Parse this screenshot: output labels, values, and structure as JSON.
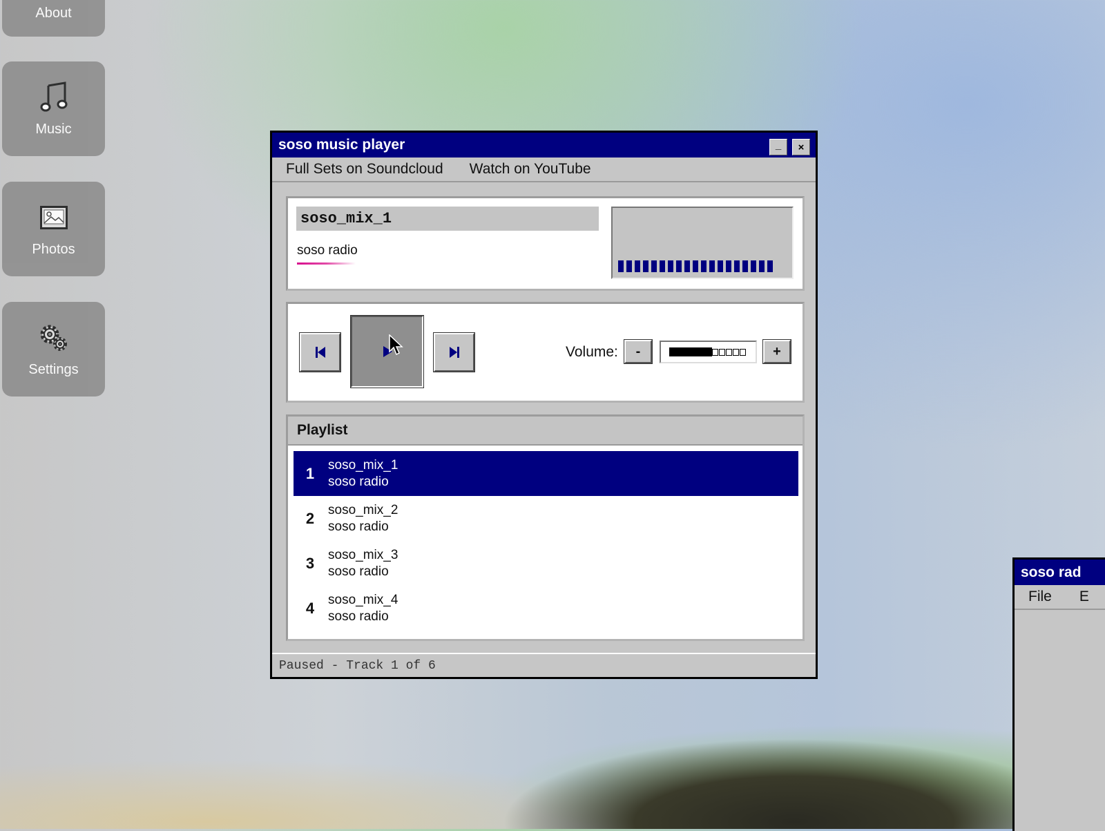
{
  "desktop": {
    "icons": [
      {
        "label": "About",
        "icon": "about-icon"
      },
      {
        "label": "Music",
        "icon": "music-note-icon"
      },
      {
        "label": "Photos",
        "icon": "photo-icon"
      },
      {
        "label": "Settings",
        "icon": "gear-icon"
      }
    ]
  },
  "player": {
    "title": "soso music player",
    "minimize": "_",
    "close": "×",
    "menu": [
      "Full Sets on Soundcloud",
      "Watch on YouTube"
    ],
    "now_playing": {
      "title": "soso_mix_1",
      "artist": "soso radio",
      "visualizer_bar_count": 19
    },
    "controls": {
      "prev_icon": "skip-previous-icon",
      "play_icon": "play-icon",
      "next_icon": "skip-next-icon",
      "volume_label": "Volume:",
      "volume_down": "-",
      "volume_up": "+",
      "volume_level": 0.55,
      "volume_empty_segments": 5
    },
    "playlist": {
      "header": "Playlist",
      "tracks": [
        {
          "num": "1",
          "title": "soso_mix_1",
          "artist": "soso radio",
          "active": true
        },
        {
          "num": "2",
          "title": "soso_mix_2",
          "artist": "soso radio",
          "active": false
        },
        {
          "num": "3",
          "title": "soso_mix_3",
          "artist": "soso radio",
          "active": false
        },
        {
          "num": "4",
          "title": "soso_mix_4",
          "artist": "soso radio",
          "active": false
        }
      ]
    },
    "status": "Paused - Track 1 of 6"
  },
  "second_window": {
    "title": "soso rad",
    "menu": [
      "File",
      "E"
    ]
  },
  "colors": {
    "titlebar": "#000080",
    "selection": "#000080",
    "accent_underline": "#d80e8e"
  }
}
